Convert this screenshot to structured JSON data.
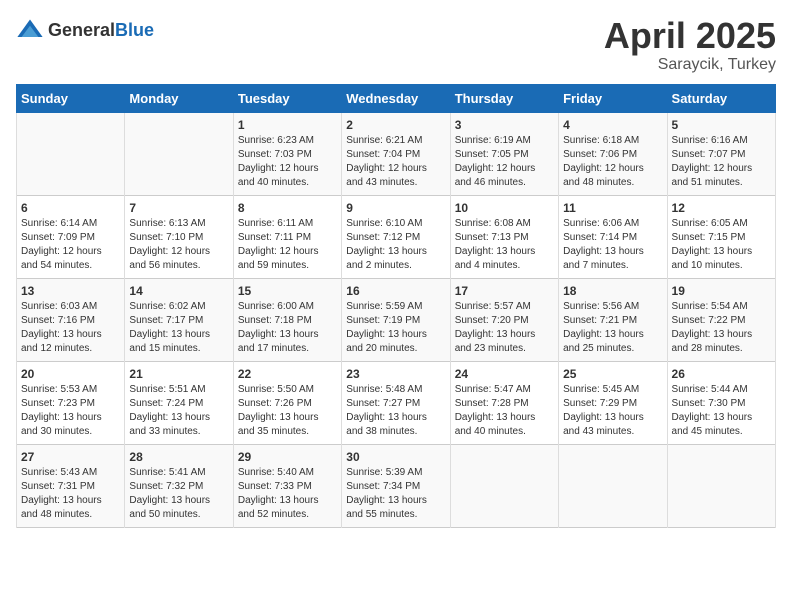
{
  "logo": {
    "general": "General",
    "blue": "Blue"
  },
  "title": {
    "month": "April 2025",
    "location": "Saraycik, Turkey"
  },
  "weekdays": [
    "Sunday",
    "Monday",
    "Tuesday",
    "Wednesday",
    "Thursday",
    "Friday",
    "Saturday"
  ],
  "rows": [
    [
      {
        "day": "",
        "sunrise": "",
        "sunset": "",
        "daylight": ""
      },
      {
        "day": "",
        "sunrise": "",
        "sunset": "",
        "daylight": ""
      },
      {
        "day": "1",
        "sunrise": "Sunrise: 6:23 AM",
        "sunset": "Sunset: 7:03 PM",
        "daylight": "Daylight: 12 hours and 40 minutes."
      },
      {
        "day": "2",
        "sunrise": "Sunrise: 6:21 AM",
        "sunset": "Sunset: 7:04 PM",
        "daylight": "Daylight: 12 hours and 43 minutes."
      },
      {
        "day": "3",
        "sunrise": "Sunrise: 6:19 AM",
        "sunset": "Sunset: 7:05 PM",
        "daylight": "Daylight: 12 hours and 46 minutes."
      },
      {
        "day": "4",
        "sunrise": "Sunrise: 6:18 AM",
        "sunset": "Sunset: 7:06 PM",
        "daylight": "Daylight: 12 hours and 48 minutes."
      },
      {
        "day": "5",
        "sunrise": "Sunrise: 6:16 AM",
        "sunset": "Sunset: 7:07 PM",
        "daylight": "Daylight: 12 hours and 51 minutes."
      }
    ],
    [
      {
        "day": "6",
        "sunrise": "Sunrise: 6:14 AM",
        "sunset": "Sunset: 7:09 PM",
        "daylight": "Daylight: 12 hours and 54 minutes."
      },
      {
        "day": "7",
        "sunrise": "Sunrise: 6:13 AM",
        "sunset": "Sunset: 7:10 PM",
        "daylight": "Daylight: 12 hours and 56 minutes."
      },
      {
        "day": "8",
        "sunrise": "Sunrise: 6:11 AM",
        "sunset": "Sunset: 7:11 PM",
        "daylight": "Daylight: 12 hours and 59 minutes."
      },
      {
        "day": "9",
        "sunrise": "Sunrise: 6:10 AM",
        "sunset": "Sunset: 7:12 PM",
        "daylight": "Daylight: 13 hours and 2 minutes."
      },
      {
        "day": "10",
        "sunrise": "Sunrise: 6:08 AM",
        "sunset": "Sunset: 7:13 PM",
        "daylight": "Daylight: 13 hours and 4 minutes."
      },
      {
        "day": "11",
        "sunrise": "Sunrise: 6:06 AM",
        "sunset": "Sunset: 7:14 PM",
        "daylight": "Daylight: 13 hours and 7 minutes."
      },
      {
        "day": "12",
        "sunrise": "Sunrise: 6:05 AM",
        "sunset": "Sunset: 7:15 PM",
        "daylight": "Daylight: 13 hours and 10 minutes."
      }
    ],
    [
      {
        "day": "13",
        "sunrise": "Sunrise: 6:03 AM",
        "sunset": "Sunset: 7:16 PM",
        "daylight": "Daylight: 13 hours and 12 minutes."
      },
      {
        "day": "14",
        "sunrise": "Sunrise: 6:02 AM",
        "sunset": "Sunset: 7:17 PM",
        "daylight": "Daylight: 13 hours and 15 minutes."
      },
      {
        "day": "15",
        "sunrise": "Sunrise: 6:00 AM",
        "sunset": "Sunset: 7:18 PM",
        "daylight": "Daylight: 13 hours and 17 minutes."
      },
      {
        "day": "16",
        "sunrise": "Sunrise: 5:59 AM",
        "sunset": "Sunset: 7:19 PM",
        "daylight": "Daylight: 13 hours and 20 minutes."
      },
      {
        "day": "17",
        "sunrise": "Sunrise: 5:57 AM",
        "sunset": "Sunset: 7:20 PM",
        "daylight": "Daylight: 13 hours and 23 minutes."
      },
      {
        "day": "18",
        "sunrise": "Sunrise: 5:56 AM",
        "sunset": "Sunset: 7:21 PM",
        "daylight": "Daylight: 13 hours and 25 minutes."
      },
      {
        "day": "19",
        "sunrise": "Sunrise: 5:54 AM",
        "sunset": "Sunset: 7:22 PM",
        "daylight": "Daylight: 13 hours and 28 minutes."
      }
    ],
    [
      {
        "day": "20",
        "sunrise": "Sunrise: 5:53 AM",
        "sunset": "Sunset: 7:23 PM",
        "daylight": "Daylight: 13 hours and 30 minutes."
      },
      {
        "day": "21",
        "sunrise": "Sunrise: 5:51 AM",
        "sunset": "Sunset: 7:24 PM",
        "daylight": "Daylight: 13 hours and 33 minutes."
      },
      {
        "day": "22",
        "sunrise": "Sunrise: 5:50 AM",
        "sunset": "Sunset: 7:26 PM",
        "daylight": "Daylight: 13 hours and 35 minutes."
      },
      {
        "day": "23",
        "sunrise": "Sunrise: 5:48 AM",
        "sunset": "Sunset: 7:27 PM",
        "daylight": "Daylight: 13 hours and 38 minutes."
      },
      {
        "day": "24",
        "sunrise": "Sunrise: 5:47 AM",
        "sunset": "Sunset: 7:28 PM",
        "daylight": "Daylight: 13 hours and 40 minutes."
      },
      {
        "day": "25",
        "sunrise": "Sunrise: 5:45 AM",
        "sunset": "Sunset: 7:29 PM",
        "daylight": "Daylight: 13 hours and 43 minutes."
      },
      {
        "day": "26",
        "sunrise": "Sunrise: 5:44 AM",
        "sunset": "Sunset: 7:30 PM",
        "daylight": "Daylight: 13 hours and 45 minutes."
      }
    ],
    [
      {
        "day": "27",
        "sunrise": "Sunrise: 5:43 AM",
        "sunset": "Sunset: 7:31 PM",
        "daylight": "Daylight: 13 hours and 48 minutes."
      },
      {
        "day": "28",
        "sunrise": "Sunrise: 5:41 AM",
        "sunset": "Sunset: 7:32 PM",
        "daylight": "Daylight: 13 hours and 50 minutes."
      },
      {
        "day": "29",
        "sunrise": "Sunrise: 5:40 AM",
        "sunset": "Sunset: 7:33 PM",
        "daylight": "Daylight: 13 hours and 52 minutes."
      },
      {
        "day": "30",
        "sunrise": "Sunrise: 5:39 AM",
        "sunset": "Sunset: 7:34 PM",
        "daylight": "Daylight: 13 hours and 55 minutes."
      },
      {
        "day": "",
        "sunrise": "",
        "sunset": "",
        "daylight": ""
      },
      {
        "day": "",
        "sunrise": "",
        "sunset": "",
        "daylight": ""
      },
      {
        "day": "",
        "sunrise": "",
        "sunset": "",
        "daylight": ""
      }
    ]
  ]
}
